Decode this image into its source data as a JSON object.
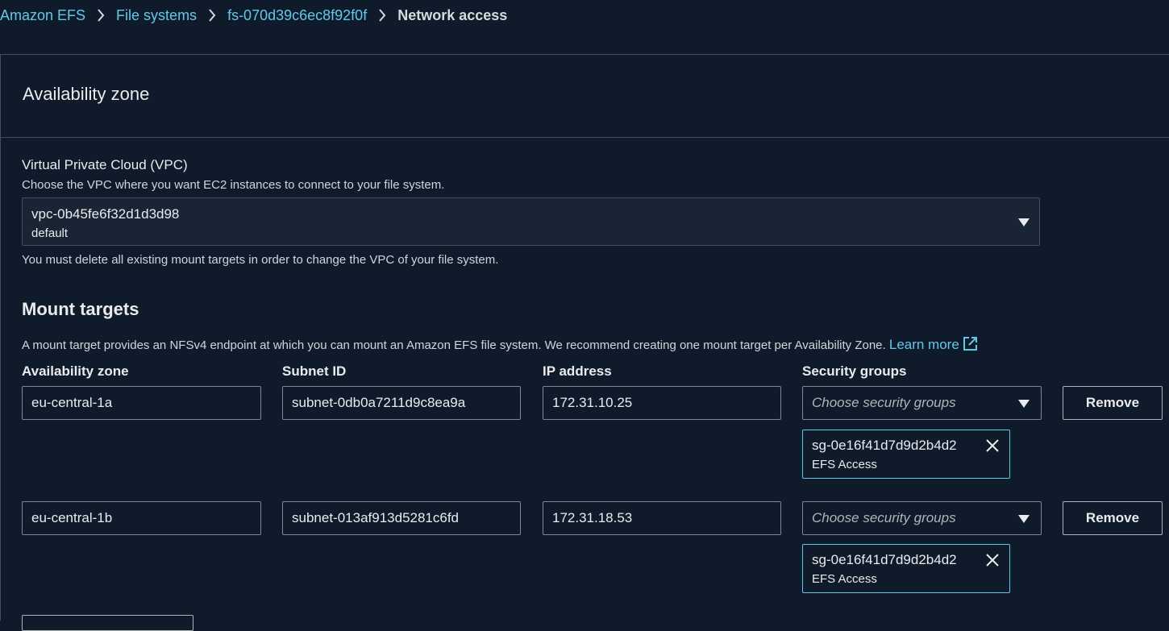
{
  "breadcrumb": {
    "items": [
      "Amazon EFS",
      "File systems",
      "fs-070d39c6ec8f92f0f"
    ],
    "current": "Network access"
  },
  "panel": {
    "title": "Availability zone"
  },
  "vpc": {
    "label": "Virtual Private Cloud (VPC)",
    "description": "Choose the VPC where you want EC2 instances to connect to your file system.",
    "selected_id": "vpc-0b45fe6f32d1d3d98",
    "selected_name": "default",
    "note": "You must delete all existing mount targets in order to change the VPC of your file system."
  },
  "mount_targets": {
    "title": "Mount targets",
    "description": "A mount target provides an NFSv4 endpoint at which you can mount an Amazon EFS file system. We recommend creating one mount target per Availability Zone.",
    "learn_more": "Learn more",
    "columns": {
      "az": "Availability zone",
      "subnet": "Subnet ID",
      "ip": "IP address",
      "sg": "Security groups"
    },
    "rows": [
      {
        "az": "eu-central-1a",
        "subnet": "subnet-0db0a7211d9c8ea9a",
        "ip": "172.31.10.25",
        "sg_placeholder": "Choose security groups",
        "remove_label": "Remove",
        "token_id": "sg-0e16f41d7d9d2b4d2",
        "token_name": "EFS Access"
      },
      {
        "az": "eu-central-1b",
        "subnet": "subnet-013af913d5281c6fd",
        "ip": "172.31.18.53",
        "sg_placeholder": "Choose security groups",
        "remove_label": "Remove",
        "token_id": "sg-0e16f41d7d9d2b4d2",
        "token_name": "EFS Access"
      }
    ]
  },
  "icons": {
    "breadcrumb_separator": "chevron-right-icon",
    "dropdown": "caret-down-icon",
    "token_remove": "close-icon",
    "external_link": "external-link-icon"
  },
  "colors": {
    "background": "#0f1b2a",
    "link": "#63c8e8",
    "border": "#414d5c"
  }
}
